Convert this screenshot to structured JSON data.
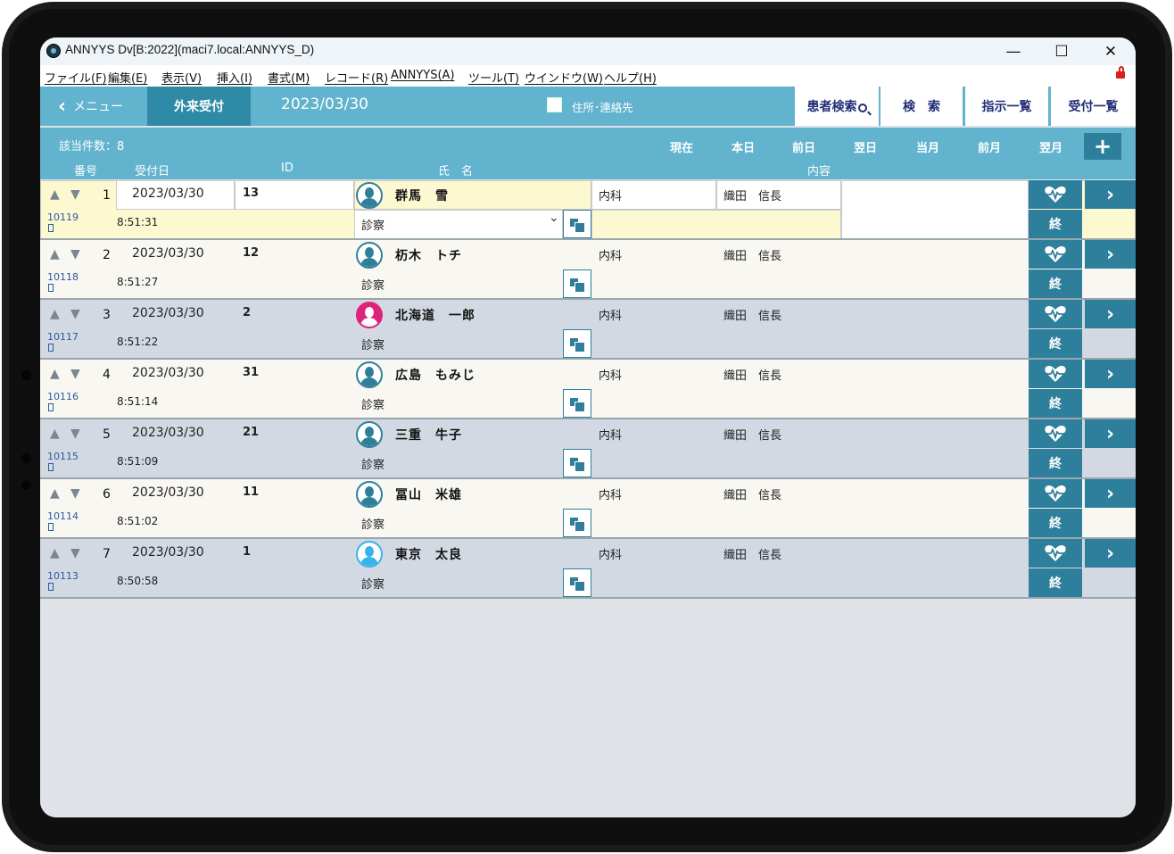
{
  "window": {
    "title": "ANNYYS Dv[B:2022](maci7.local:ANNYYS_D)",
    "minimize": "—",
    "maximize": "☐",
    "close": "✕"
  },
  "menubar": [
    "ファイル(F)",
    "編集(E)",
    "表示(V)",
    "挿入(I)",
    "書式(M)",
    "レコード(R)",
    "ANNYYS(A)",
    "ツール(T)",
    "ウインドウ(W)",
    "ヘルプ(H)"
  ],
  "toolbar": {
    "menu_label": "メニュー",
    "active_tab": "外来受付",
    "date": "2023/03/30",
    "address_checkbox_label": "住所･連絡先",
    "buttons": [
      "患者検索",
      "検　索",
      "指示一覧",
      "受付一覧"
    ]
  },
  "subbar": {
    "count_label": "該当件数：8",
    "periods": [
      "現在",
      "本日",
      "前日",
      "翌日",
      "当月",
      "前月",
      "翌月"
    ],
    "add_label": "+",
    "headers": [
      "番号",
      "受付日",
      "ID",
      "氏　名",
      "内容"
    ]
  },
  "colors": {
    "accent": "#62b3ce",
    "dark_accent": "#2e7f9c",
    "selected_row": "#fcf8d0",
    "row_light": "#f8f7f1",
    "row_dark": "#d2d9e2",
    "female": "#e0237a",
    "male": "#2f7f9b",
    "child": "#37b3e9"
  },
  "rows": [
    {
      "num": "1",
      "date": "2023/03/30",
      "id": "13",
      "name": "群馬　雪",
      "record": "10119",
      "time": "8:51:31",
      "type": "診察",
      "dept": "内科",
      "doctor": "織田　信長",
      "finish": "終",
      "avatar": "male"
    },
    {
      "num": "2",
      "date": "2023/03/30",
      "id": "12",
      "name": "杤木　トチ",
      "record": "10118",
      "time": "8:51:27",
      "type": "診察",
      "dept": "内科",
      "doctor": "織田　信長",
      "finish": "終",
      "avatar": "male"
    },
    {
      "num": "3",
      "date": "2023/03/30",
      "id": "2",
      "name": "北海道　一郎",
      "record": "10117",
      "time": "8:51:22",
      "type": "診察",
      "dept": "内科",
      "doctor": "織田　信長",
      "finish": "終",
      "avatar": "female"
    },
    {
      "num": "4",
      "date": "2023/03/30",
      "id": "31",
      "name": "広島　もみじ",
      "record": "10116",
      "time": "8:51:14",
      "type": "診察",
      "dept": "内科",
      "doctor": "織田　信長",
      "finish": "終",
      "avatar": "male"
    },
    {
      "num": "5",
      "date": "2023/03/30",
      "id": "21",
      "name": "三重　牛子",
      "record": "10115",
      "time": "8:51:09",
      "type": "診察",
      "dept": "内科",
      "doctor": "織田　信長",
      "finish": "終",
      "avatar": "male"
    },
    {
      "num": "6",
      "date": "2023/03/30",
      "id": "11",
      "name": "冨山　米雄",
      "record": "10114",
      "time": "8:51:02",
      "type": "診察",
      "dept": "内科",
      "doctor": "織田　信長",
      "finish": "終",
      "avatar": "male"
    },
    {
      "num": "7",
      "date": "2023/03/30",
      "id": "1",
      "name": "東京　太良",
      "record": "10113",
      "time": "8:50:58",
      "type": "診察",
      "dept": "内科",
      "doctor": "織田　信長",
      "finish": "終",
      "avatar": "child"
    }
  ]
}
